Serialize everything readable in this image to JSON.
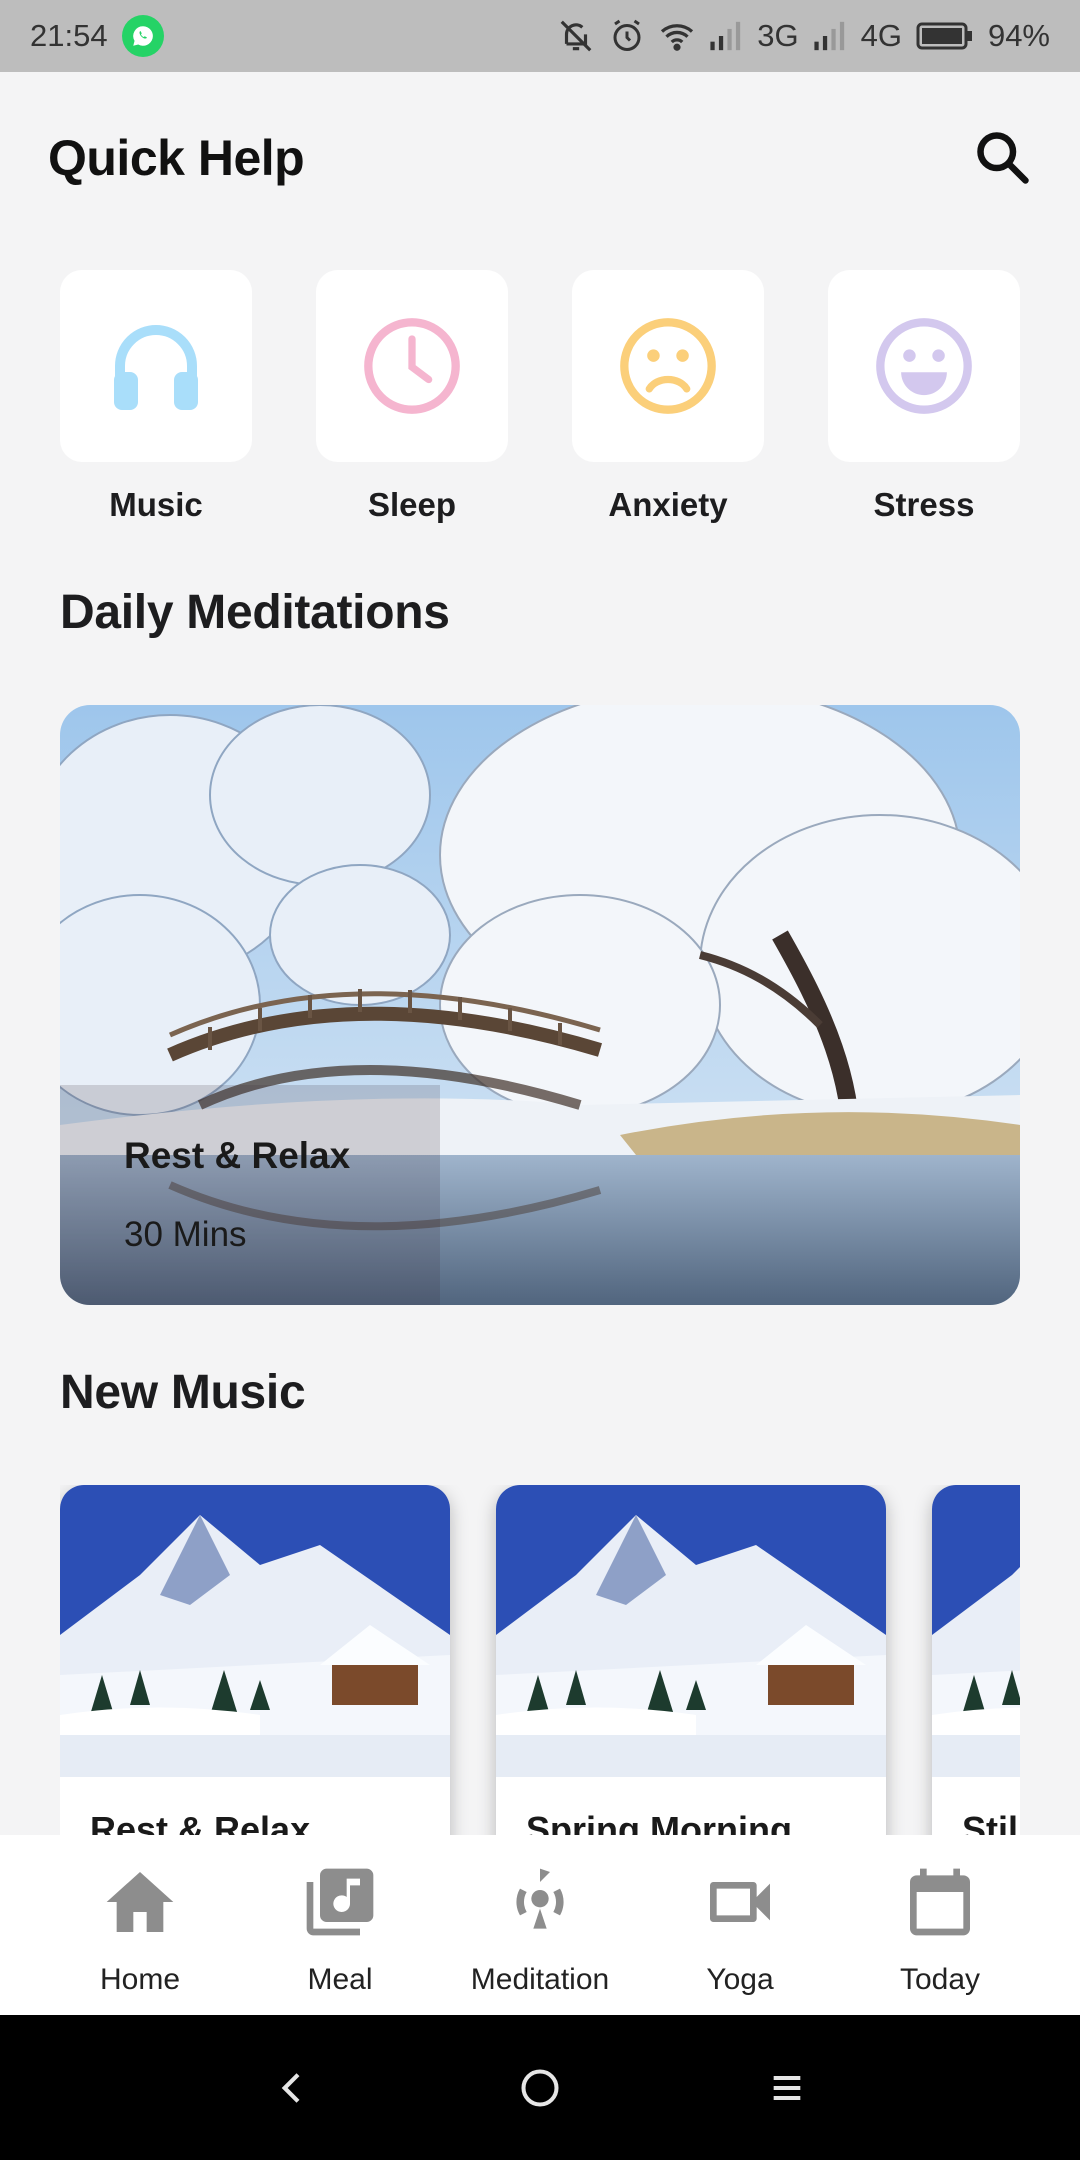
{
  "status_bar": {
    "time": "21:54",
    "network_3g": "3G",
    "network_4g": "4G",
    "battery": "94%"
  },
  "header": {
    "title": "Quick Help",
    "search_icon": "search-icon"
  },
  "quick_help": [
    {
      "label": "Music",
      "icon": "headphones-icon",
      "color": "#a9defa"
    },
    {
      "label": "Sleep",
      "icon": "clock-icon",
      "color": "#f5b5cf"
    },
    {
      "label": "Anxiety",
      "icon": "sad-face-icon",
      "color": "#fbcf7a"
    },
    {
      "label": "Stress",
      "icon": "smile-face-icon",
      "color": "#d3c8ee"
    }
  ],
  "daily_meditations": {
    "section_title": "Daily Meditations",
    "card": {
      "title": "Rest & Relax",
      "duration": "30 Mins"
    }
  },
  "new_music": {
    "section_title": "New Music",
    "cards": [
      {
        "title": "Rest & Relax"
      },
      {
        "title": "Spring Morning"
      },
      {
        "title": "Still"
      }
    ]
  },
  "bottom_nav": [
    {
      "label": "Home",
      "icon": "home-icon"
    },
    {
      "label": "Meal",
      "icon": "music-library-icon"
    },
    {
      "label": "Meditation",
      "icon": "meditation-icon"
    },
    {
      "label": "Yoga",
      "icon": "video-camera-icon"
    },
    {
      "label": "Today",
      "icon": "calendar-icon"
    }
  ],
  "colors": {
    "background": "#f4f4f5",
    "nav_icon": "#8d8d8d",
    "status_bar": "#bdbdbd"
  }
}
